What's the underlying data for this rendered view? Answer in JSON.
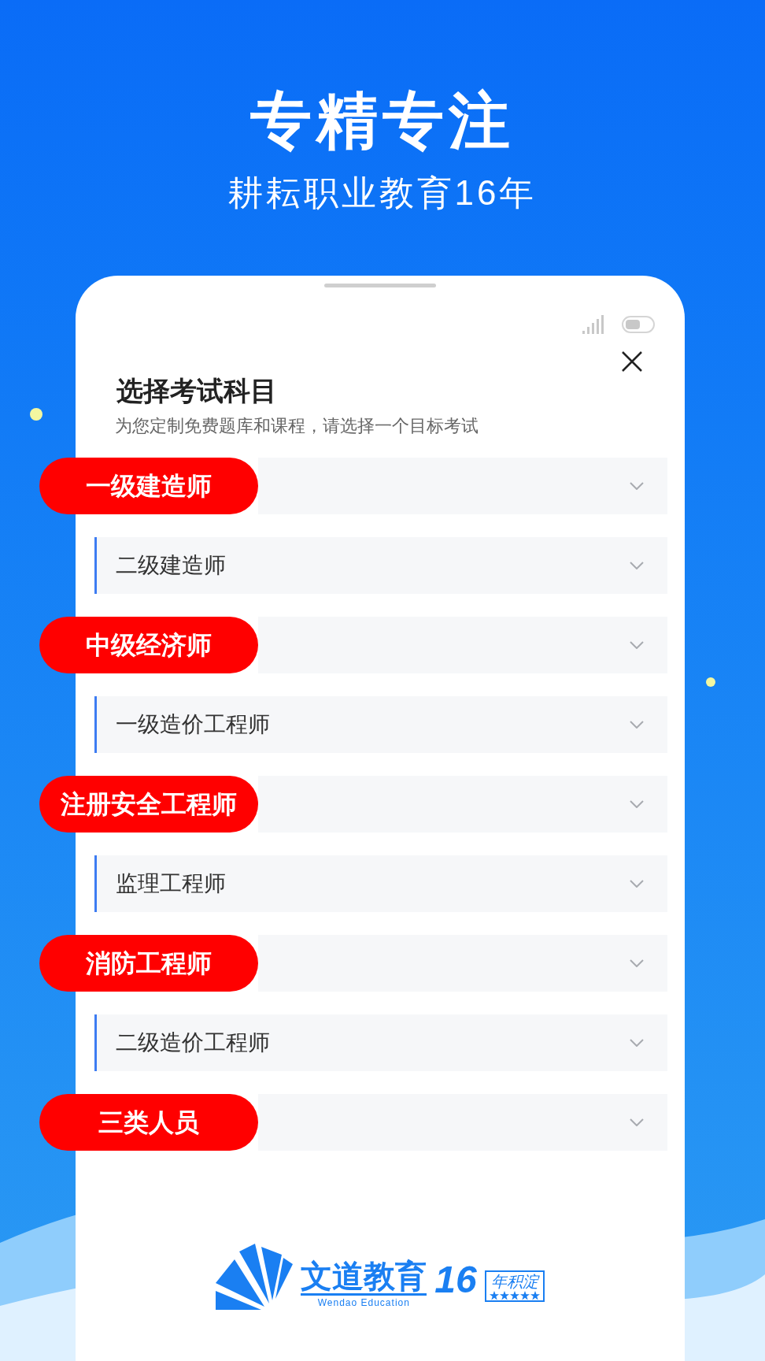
{
  "hero": {
    "title": "专精专注",
    "subtitle": "耕耘职业教育16年"
  },
  "sheet": {
    "title": "选择考试科目",
    "subtitle": "为您定制免费题库和课程，请选择一个目标考试"
  },
  "exams": [
    {
      "label": "一级建造师",
      "kind": "badge"
    },
    {
      "label": "二级建造师",
      "kind": "plain"
    },
    {
      "label": "中级经济师",
      "kind": "badge"
    },
    {
      "label": "一级造价工程师",
      "kind": "plain"
    },
    {
      "label": "注册安全工程师",
      "kind": "badge"
    },
    {
      "label": "监理工程师",
      "kind": "plain"
    },
    {
      "label": "消防工程师",
      "kind": "badge"
    },
    {
      "label": "二级造价工程师",
      "kind": "plain"
    },
    {
      "label": "三类人员",
      "kind": "badge"
    }
  ],
  "logo": {
    "name": "文道教育",
    "years": "16",
    "tag": "年积淀",
    "english": "Wendao Education"
  }
}
